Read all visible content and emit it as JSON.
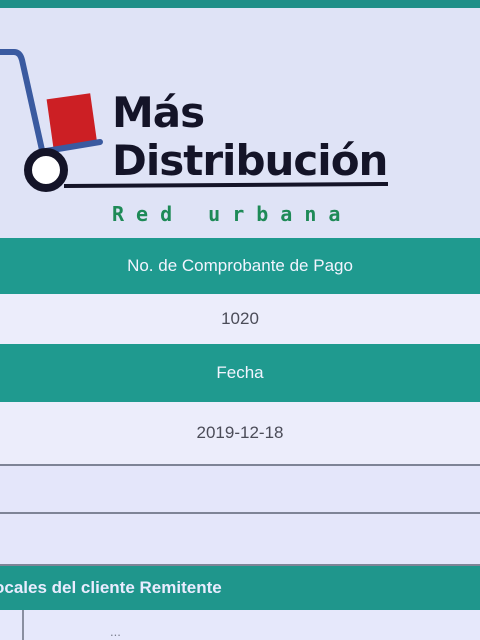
{
  "brand": {
    "line1": "Más",
    "line2": "Distribución",
    "tagline": "Red urbana"
  },
  "receipt": {
    "number_label": "No. de Comprobante de Pago",
    "number_value": "1020",
    "date_label": "Fecha",
    "date_value": "2019-12-18"
  },
  "sender_section": {
    "title": "ocales del cliente Remitente",
    "first_row_text": "..."
  },
  "colors": {
    "teal": "#1f9a8f",
    "logo_red": "#cc1f24",
    "logo_navy": "#141428",
    "logo_blue": "#3a5aa0",
    "tagline_green": "#1e8a57"
  },
  "icons": {
    "logo": "hand-truck-icon"
  }
}
